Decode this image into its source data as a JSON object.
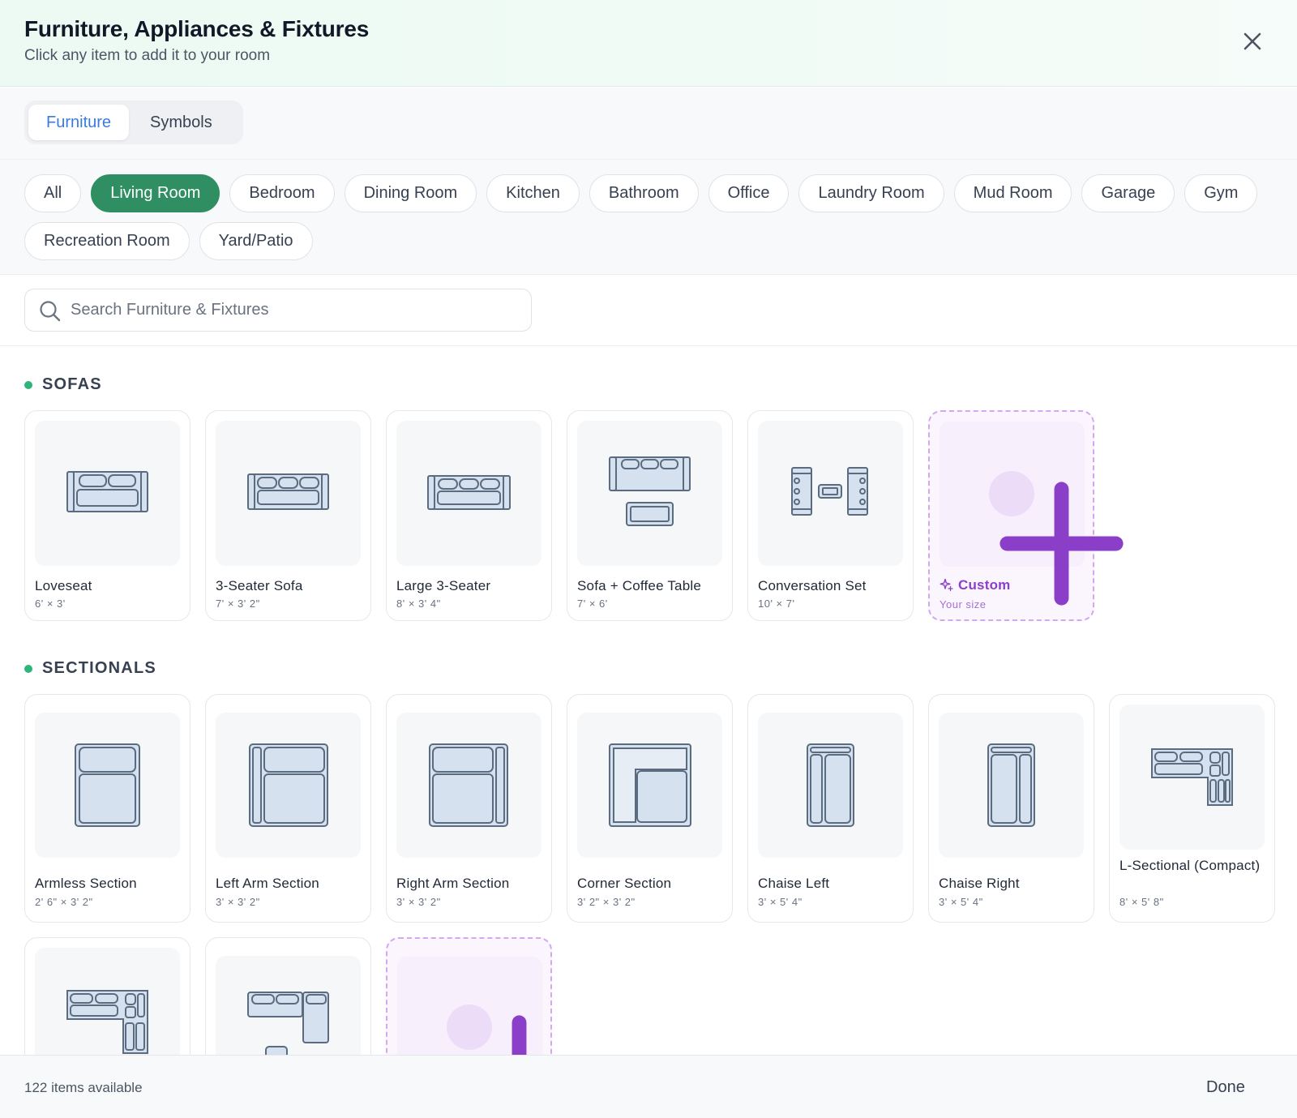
{
  "header": {
    "title": "Furniture, Appliances & Fixtures",
    "subtitle": "Click any item to add it to your room"
  },
  "tabs": [
    {
      "label": "Furniture",
      "active": true
    },
    {
      "label": "Symbols",
      "active": false
    }
  ],
  "filters": [
    "All",
    "Living Room",
    "Bedroom",
    "Dining Room",
    "Kitchen",
    "Bathroom",
    "Office",
    "Laundry Room",
    "Mud Room",
    "Garage",
    "Gym",
    "Recreation Room",
    "Yard/Patio"
  ],
  "active_filter": "Living Room",
  "search": {
    "placeholder": "Search Furniture & Fixtures",
    "value": ""
  },
  "sections": {
    "sofas": {
      "title": "SOFAS",
      "items": [
        {
          "name": "Loveseat",
          "dims": "6' × 3'"
        },
        {
          "name": "3-Seater Sofa",
          "dims": "7' × 3' 2\""
        },
        {
          "name": "Large 3-Seater",
          "dims": "8' × 3' 4\""
        },
        {
          "name": "Sofa + Coffee Table",
          "dims": "7' × 6'"
        },
        {
          "name": "Conversation Set",
          "dims": "10' × 7'"
        }
      ],
      "custom": {
        "name": "Custom",
        "dims": "Your size"
      }
    },
    "sectionals": {
      "title": "SECTIONALS",
      "items": [
        {
          "name": "Armless Section",
          "dims": "2' 6\" × 3' 2\""
        },
        {
          "name": "Left Arm Section",
          "dims": "3' × 3' 2\""
        },
        {
          "name": "Right Arm Section",
          "dims": "3' × 3' 2\""
        },
        {
          "name": "Corner Section",
          "dims": "3' 2\" × 3' 2\""
        },
        {
          "name": "Chaise Left",
          "dims": "3' × 5' 4\""
        },
        {
          "name": "Chaise Right",
          "dims": "3' × 5' 4\""
        },
        {
          "name": "L-Sectional (Compact)",
          "dims": "8' × 5' 8\""
        }
      ]
    }
  },
  "footer": {
    "count": "122 items available",
    "done_label": "Done"
  },
  "colors": {
    "accent_green": "#2f8f63",
    "tab_active": "#3b7be0",
    "custom_purple": "#8b3fc9",
    "icon_stroke": "#5b6b80",
    "icon_fill": "#d5e1ee"
  }
}
